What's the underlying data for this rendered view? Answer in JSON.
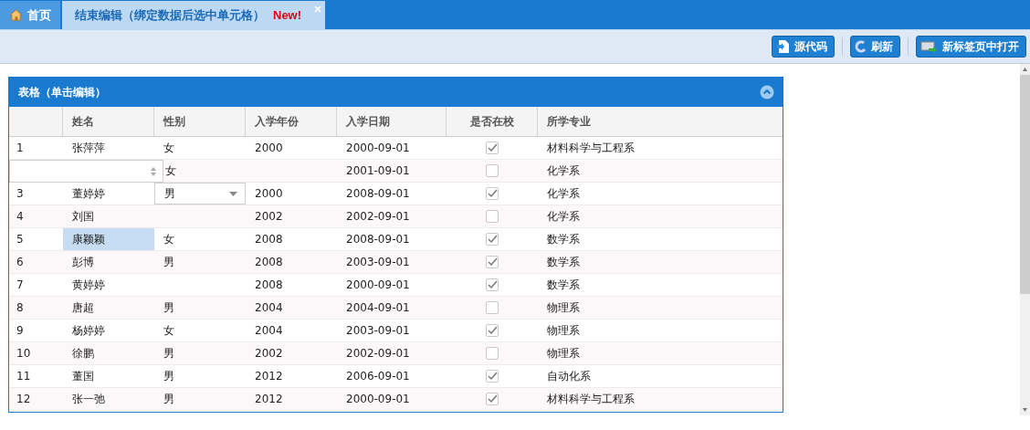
{
  "tabs": [
    {
      "label": "首页",
      "selected": false
    },
    {
      "label": "结束编辑（绑定数据后选中单元格）",
      "badge": "New!",
      "selected": true
    }
  ],
  "toolbar": {
    "buttons": [
      {
        "label": "源代码"
      },
      {
        "label": "刷新"
      },
      {
        "label": "新标签页中打开"
      }
    ]
  },
  "panel": {
    "title": "表格（单击编辑）",
    "collapsed": false,
    "table": {
      "columns": [
        "姓名",
        "性别",
        "入学年份",
        "入学日期",
        "是否在校",
        "所学专业"
      ],
      "rows": [
        {
          "kind": "plain",
          "number": "1",
          "name": {
            "text": "张萍萍",
            "selected": false
          },
          "gender": "女",
          "year": "2000",
          "date": "2000-09-01",
          "in_school": true,
          "major": "材料科学与工程系"
        },
        {
          "kind": "spinner",
          "gender": "女",
          "date": "2001-09-01",
          "in_school": false,
          "major": "化学系"
        },
        {
          "kind": "dropdown",
          "number": "3",
          "name": {
            "text": "董婷婷",
            "selected": false
          },
          "gender": "男",
          "year": "2000",
          "date": "2008-09-01",
          "in_school": true,
          "major": "化学系"
        },
        {
          "kind": "plain",
          "number": "4",
          "name": {
            "text": "刘国",
            "selected": false
          },
          "year": "2002",
          "date": "2002-09-01",
          "in_school": false,
          "major": "化学系"
        },
        {
          "kind": "plain",
          "number": "5",
          "name": {
            "text": "康颖颖",
            "selected": true
          },
          "gender": "女",
          "year": "2008",
          "date": "2008-09-01",
          "in_school": true,
          "major": "数学系"
        },
        {
          "kind": "plain",
          "number": "6",
          "name": {
            "text": "彭博",
            "selected": false
          },
          "gender": "男",
          "year": "2008",
          "date": "2003-09-01",
          "in_school": true,
          "major": "数学系"
        },
        {
          "kind": "plain",
          "number": "7",
          "name": {
            "text": "黄婷婷",
            "selected": false
          },
          "year": "2008",
          "date": "2000-09-01",
          "in_school": true,
          "major": "数学系"
        },
        {
          "kind": "plain",
          "number": "8",
          "name": {
            "text": "唐超",
            "selected": false
          },
          "gender": "男",
          "year": "2004",
          "date": "2004-09-01",
          "in_school": false,
          "major": "物理系"
        },
        {
          "kind": "plain",
          "number": "9",
          "name": {
            "text": "杨婷婷",
            "selected": false
          },
          "gender": "女",
          "year": "2004",
          "date": "2003-09-01",
          "in_school": true,
          "major": "物理系"
        },
        {
          "kind": "plain",
          "number": "10",
          "name": {
            "text": "徐鹏",
            "selected": false
          },
          "gender": "男",
          "year": "2002",
          "date": "2002-09-01",
          "in_school": false,
          "major": "物理系"
        },
        {
          "kind": "plain",
          "number": "11",
          "name": {
            "text": "董国",
            "selected": false
          },
          "gender": "男",
          "year": "2012",
          "date": "2006-09-01",
          "in_school": true,
          "major": "自动化系"
        },
        {
          "kind": "plain",
          "number": "12",
          "name": {
            "text": "张一弛",
            "selected": false
          },
          "gender": "男",
          "year": "2012",
          "date": "2000-09-01",
          "in_school": true,
          "major": "材料科学与工程系"
        }
      ]
    }
  }
}
